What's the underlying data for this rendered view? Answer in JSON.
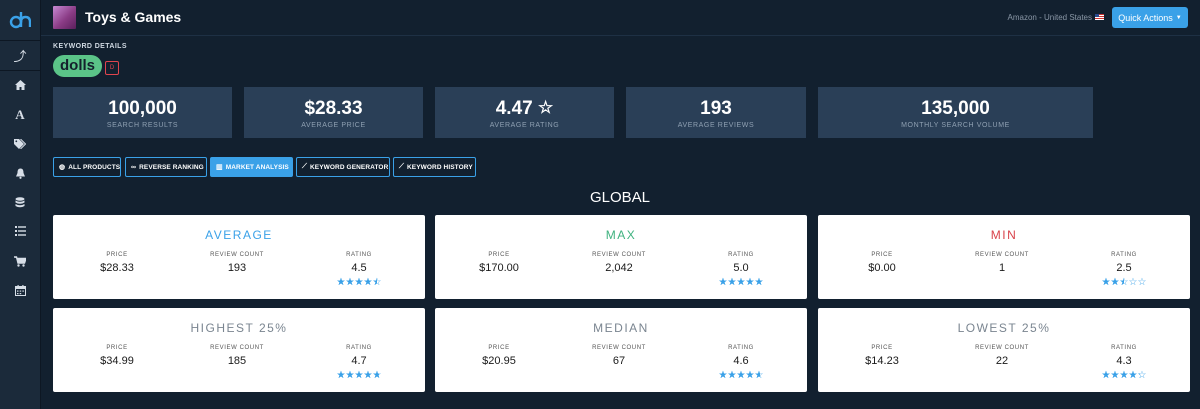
{
  "header": {
    "category_title": "Toys & Games",
    "marketplace": "Amazon - United States",
    "quick_actions_label": "Quick Actions"
  },
  "keyword": {
    "section_label": "KEYWORD DETAILS",
    "term": "dolls",
    "delete_glyph": "D"
  },
  "stats": [
    {
      "value": "100,000",
      "label": "SEARCH RESULTS"
    },
    {
      "value": "$28.33",
      "label": "AVERAGE PRICE"
    },
    {
      "value": "4.47",
      "label": "AVERAGE RATING"
    },
    {
      "value": "193",
      "label": "AVERAGE REVIEWS"
    },
    {
      "value": "135,000",
      "label": "MONTHLY SEARCH VOLUME"
    }
  ],
  "tabs": [
    {
      "label": "ALL PRODUCTS",
      "icon": "globe-icon",
      "active": false
    },
    {
      "label": "REVERSE RANKING",
      "icon": "binoculars-icon",
      "active": false
    },
    {
      "label": "MARKET ANALYSIS",
      "icon": "chart-icon",
      "active": true
    },
    {
      "label": "KEYWORD GENERATOR",
      "icon": "magic-wand-icon",
      "active": false
    },
    {
      "label": "KEYWORD HISTORY",
      "icon": "magic-wand-icon",
      "active": false
    }
  ],
  "section_title": "GLOBAL",
  "column_labels": {
    "price": "PRICE",
    "reviews": "REVIEW COUNT",
    "rating": "RATING"
  },
  "cards": [
    {
      "title": "AVERAGE",
      "color": "#3aa1e8",
      "price": "$28.33",
      "reviews": "193",
      "rating": "4.5",
      "stars_value": 4.5
    },
    {
      "title": "MAX",
      "color": "#3fb27f",
      "price": "$170.00",
      "reviews": "2,042",
      "rating": "5.0",
      "stars_value": 5.0
    },
    {
      "title": "MIN",
      "color": "#d9434b",
      "price": "$0.00",
      "reviews": "1",
      "rating": "2.5",
      "stars_value": 2.5
    },
    {
      "title": "HIGHEST 25%",
      "color": "#7a8590",
      "price": "$34.99",
      "reviews": "185",
      "rating": "4.7",
      "stars_value": 4.7
    },
    {
      "title": "MEDIAN",
      "color": "#7a8590",
      "price": "$20.95",
      "reviews": "67",
      "rating": "4.6",
      "stars_value": 4.6
    },
    {
      "title": "LOWEST 25%",
      "color": "#7a8590",
      "price": "$14.23",
      "reviews": "22",
      "rating": "4.3",
      "stars_value": 4.3
    }
  ],
  "colors": {
    "accent": "#3aa1e8",
    "background": "#12202f",
    "stat_box": "#2a3f57",
    "keyword_pill": "#5bc488"
  }
}
